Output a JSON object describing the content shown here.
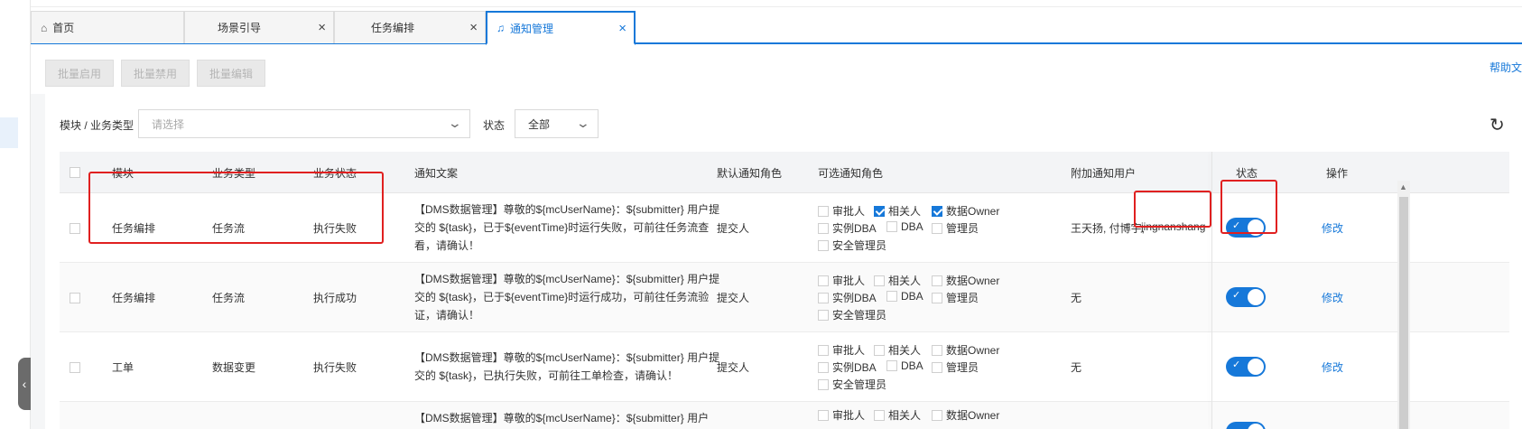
{
  "tabs": [
    {
      "label": "首页",
      "icon": "home-icon",
      "active": false,
      "closable": false
    },
    {
      "label": "场景引导",
      "active": false,
      "closable": true
    },
    {
      "label": "任务编排",
      "active": false,
      "closable": true
    },
    {
      "label": "通知管理",
      "icon": "bell-icon",
      "active": true,
      "closable": true
    }
  ],
  "toolbar": {
    "batch_enable": "批量启用",
    "batch_disable": "批量禁用",
    "batch_edit": "批量编辑",
    "help": "帮助文"
  },
  "filters": {
    "module_label": "模块 / 业务类型",
    "module_placeholder": "请选择",
    "status_label": "状态",
    "status_value": "全部"
  },
  "table": {
    "headers": {
      "module": "模块",
      "biz_type": "业务类型",
      "biz_status": "业务状态",
      "copy": "通知文案",
      "default_role": "默认通知角色",
      "optional_roles": "可选通知角色",
      "extra_users": "附加通知用户",
      "status": "状态",
      "action": "操作"
    },
    "role_labels": {
      "approver": "审批人",
      "related": "相关人",
      "data_owner": "数据Owner",
      "instance_dba": "实例DBA",
      "dba": "DBA",
      "admin": "管理员",
      "security_admin": "安全管理员"
    },
    "rows": [
      {
        "module": "任务编排",
        "biz_type": "任务流",
        "biz_status": "执行失败",
        "copy": "【DMS数据管理】尊敬的${mcUserName}：${submitter} 用户提交的 ${task}，已于${eventTime}时运行失败，可前往任务流查看，请确认！",
        "default_role": "提交人",
        "roles_checked": {
          "related": true,
          "data_owner": true
        },
        "extra_users": "王天扬, 付博宇,",
        "extra_users_2": "jingnanshang",
        "enabled": true,
        "action": "修改"
      },
      {
        "module": "任务编排",
        "biz_type": "任务流",
        "biz_status": "执行成功",
        "copy": "【DMS数据管理】尊敬的${mcUserName}：${submitter} 用户提交的 ${task}，已于${eventTime}时运行成功，可前往任务流验证，请确认！",
        "default_role": "提交人",
        "roles_checked": {},
        "extra_users": "无",
        "enabled": true,
        "action": "修改"
      },
      {
        "module": "工单",
        "biz_type": "数据变更",
        "biz_status": "执行失败",
        "copy": "【DMS数据管理】尊敬的${mcUserName}：${submitter} 用户提交的 ${task}，已执行失败，可前往工单检查，请确认！",
        "default_role": "提交人",
        "roles_checked": {},
        "extra_users": "无",
        "enabled": true,
        "action": "修改"
      },
      {
        "copy": "【DMS数据管理】尊敬的${mcUserName}：${submitter} 用户"
      }
    ]
  },
  "colors": {
    "primary": "#1678d9",
    "highlight_box": "#e02020"
  }
}
